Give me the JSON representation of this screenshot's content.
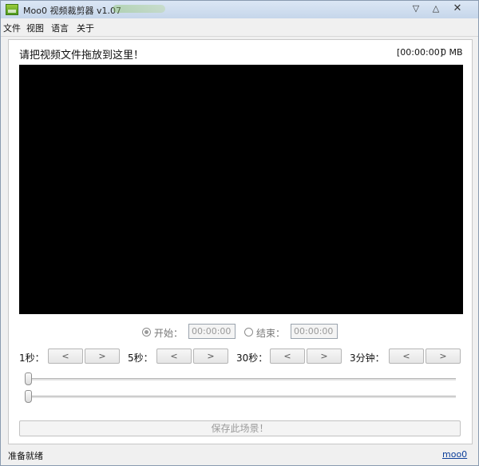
{
  "window": {
    "title": "Moo0 视频裁剪器 v1.07",
    "minimize_symbol": "▽",
    "maximize_symbol": "△",
    "close_symbol": "✕"
  },
  "menu": {
    "items": [
      "文件",
      "视图",
      "语言",
      "关于"
    ]
  },
  "main": {
    "drop_hint": "请把视频文件拖放到这里！",
    "time_readout": "[00:00:00]",
    "size_readout": "0 MB"
  },
  "range": {
    "start_label": "开始：",
    "start_value": "00:00:00",
    "start_selected": true,
    "end_label": "结束：",
    "end_value": "00:00:00",
    "end_selected": false
  },
  "steps": [
    {
      "label": "1秒：",
      "back": "<",
      "forward": ">"
    },
    {
      "label": "5秒：",
      "back": "<",
      "forward": ">"
    },
    {
      "label": "30秒：",
      "back": "<",
      "forward": ">"
    },
    {
      "label": "3分钟：",
      "back": "<",
      "forward": ">"
    }
  ],
  "sliders": {
    "upper_position": 0,
    "lower_position": 0
  },
  "save_button": "保存此场景！",
  "status": {
    "text": "准备就绪",
    "link": "moo0"
  },
  "colors": {
    "video_background": "#000000",
    "link": "#0b3e9a",
    "disabled_text": "#9a9a9a"
  }
}
